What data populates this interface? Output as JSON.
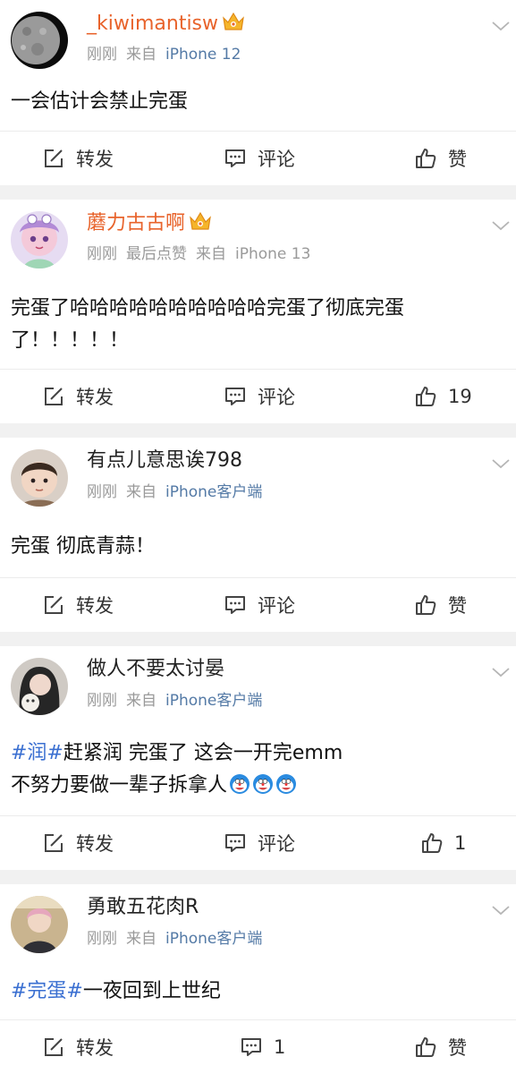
{
  "posts": [
    {
      "username": "_kiwimantisw",
      "meta": [
        "刚刚",
        "来自"
      ],
      "device": "iPhone 12",
      "text_lines": [
        "一会估计会禁止完蛋"
      ],
      "actions": {
        "repost": "转发",
        "comment": "评论",
        "like": "赞"
      }
    },
    {
      "username": "蘑力古古啊",
      "meta": [
        "刚刚",
        "最后点赞",
        "来自"
      ],
      "device": "iPhone 13",
      "text_lines": [
        "完蛋了哈哈哈哈哈哈哈哈哈哈完蛋了彻底完蛋",
        "了！！！！！"
      ],
      "actions": {
        "repost": "转发",
        "comment": "评论",
        "like": "19"
      }
    },
    {
      "username": "有点儿意思诶798",
      "meta": [
        "刚刚",
        "来自"
      ],
      "device": "iPhone客户端",
      "text_lines": [
        "完蛋 彻底青蒜！"
      ],
      "actions": {
        "repost": "转发",
        "comment": "评论",
        "like": "赞"
      }
    },
    {
      "username": "做人不要太讨晏",
      "meta": [
        "刚刚",
        "来自"
      ],
      "device": "iPhone客户端",
      "hashtag": "#润#",
      "text_rest": "赶紧润 完蛋了 这会一开完emm",
      "text_line2": "不努力要做一辈子拆拿人",
      "actions": {
        "repost": "转发",
        "comment": "评论",
        "like": "1"
      }
    },
    {
      "username": "勇敢五花肉R",
      "meta": [
        "刚刚",
        "来自"
      ],
      "device": "iPhone客户端",
      "hashtag": "#完蛋#",
      "text_rest": "一夜回到上世纪",
      "actions": {
        "repost": "转发",
        "comment": "1",
        "like": "赞"
      }
    }
  ],
  "icons": {
    "repost": "edit-square-icon",
    "comment": "comment-bubble-icon",
    "like": "thumbs-up-icon",
    "more": "chevron-down-icon",
    "vip": "vip-crown-icon"
  },
  "colors": {
    "vip_name": "#e8632b",
    "link": "#547aa6",
    "hashtag": "#3a6fd1",
    "meta": "#9a9a9a"
  }
}
